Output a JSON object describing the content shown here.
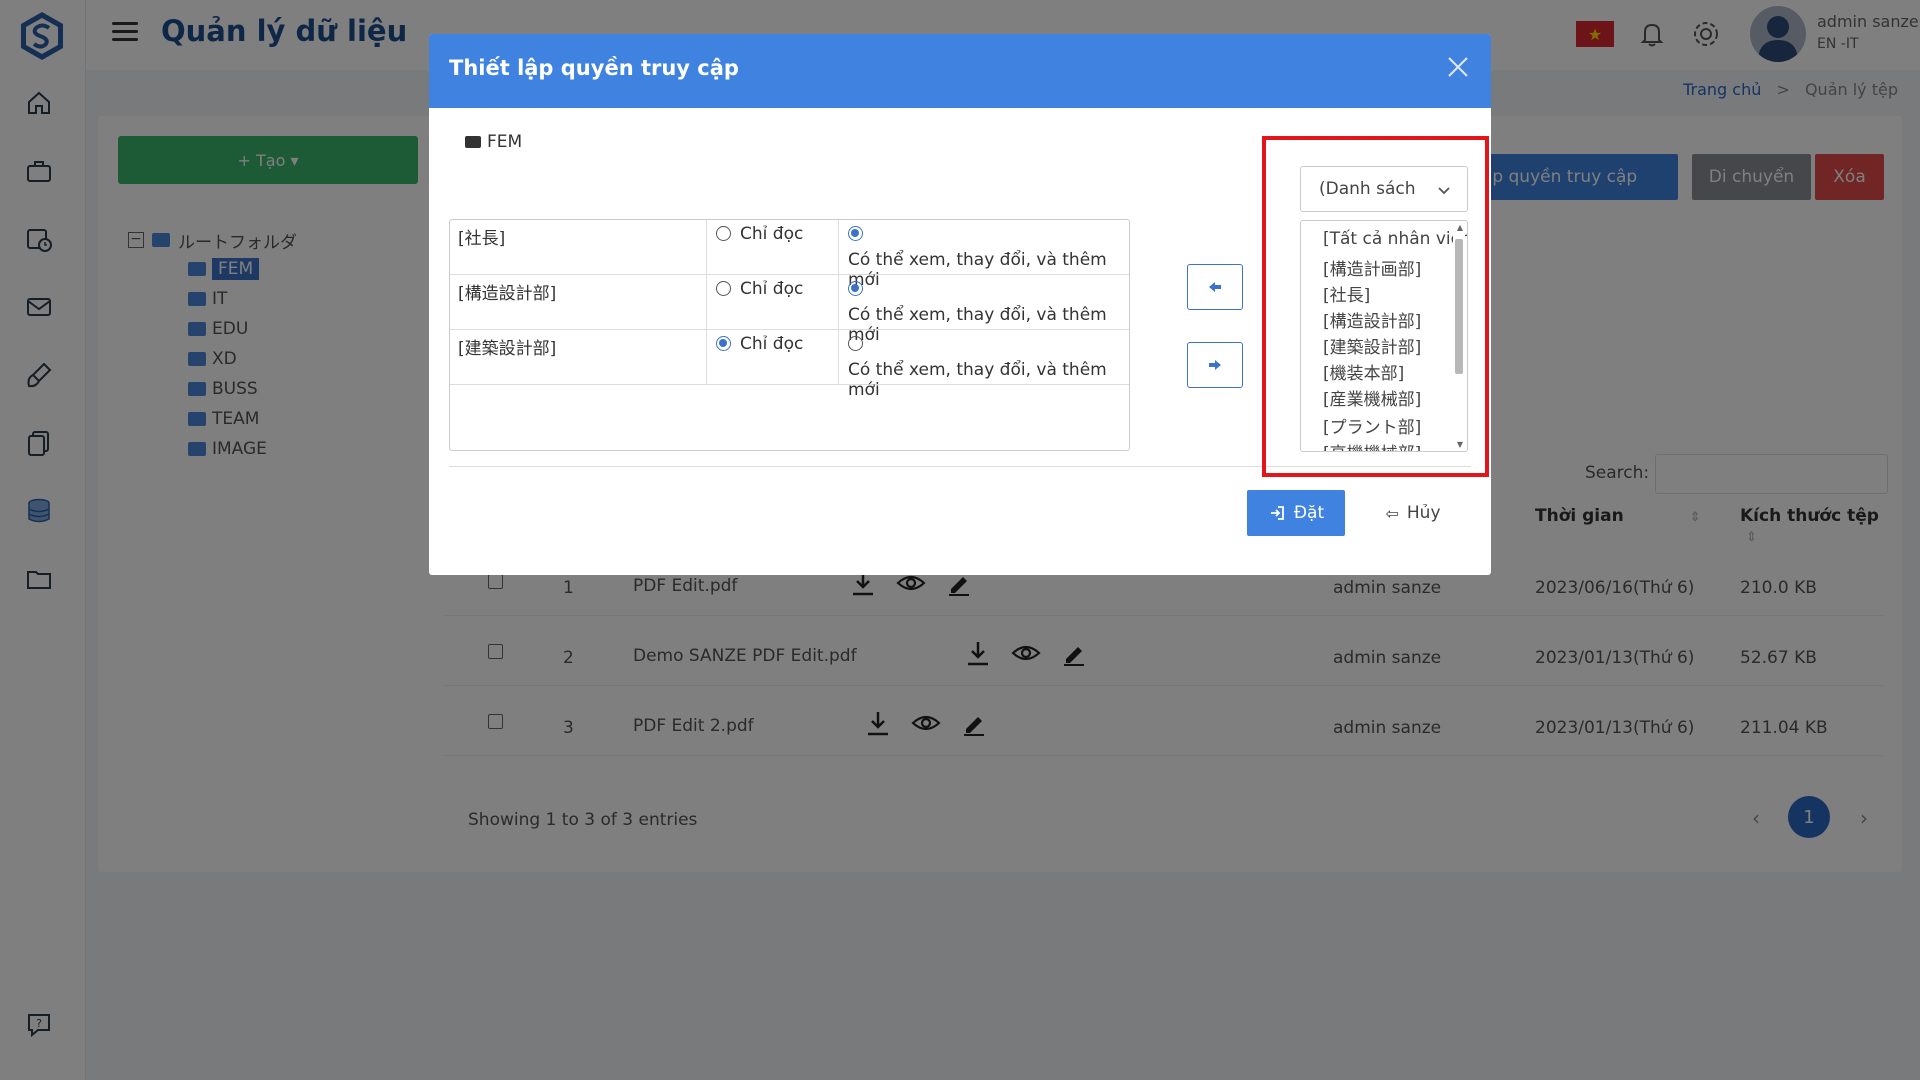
{
  "header": {
    "title": "Quản lý dữ liệu",
    "user_name": "admin sanze",
    "user_sub": "EN -IT",
    "flag_icon": "vietnam-flag-icon"
  },
  "breadcrumb": {
    "home": "Trang chủ",
    "sep": ">",
    "current": "Quản lý tệp"
  },
  "sidebar": {
    "icons": [
      "home-icon",
      "briefcase-icon",
      "calendar-clock-icon",
      "mail-icon",
      "brush-icon",
      "documents-icon",
      "database-icon",
      "folder-icon",
      "help-chat-icon"
    ]
  },
  "content": {
    "create_label": "+ Tạo ▾",
    "tree": {
      "root": "ルートフォルダ",
      "items": [
        "FEM",
        "IT",
        "EDU",
        "XD",
        "BUSS",
        "TEAM",
        "IMAGE"
      ],
      "selected": "FEM"
    },
    "actions": {
      "access": "Thiết lập quyền truy cập",
      "move": "Di chuyển",
      "delete": "Xóa"
    },
    "search_label": "Search:",
    "columns": {
      "time": "Thời gian",
      "size": "Kích thước tệp"
    },
    "rows": [
      {
        "num": "1",
        "name": "PDF Edit.pdf",
        "by": "admin sanze",
        "time": "2023/06/16(Thứ 6)",
        "size": "210.0 KB"
      },
      {
        "num": "2",
        "name": "Demo SANZE PDF Edit.pdf",
        "by": "admin sanze",
        "time": "2023/01/13(Thứ 6)",
        "size": "52.67 KB"
      },
      {
        "num": "3",
        "name": "PDF Edit 2.pdf",
        "by": "admin sanze",
        "time": "2023/01/13(Thứ 6)",
        "size": "211.04 KB"
      }
    ],
    "showing": "Showing 1 to 3 of 3 entries",
    "pager": {
      "prev": "‹",
      "current": "1",
      "next": "›"
    }
  },
  "modal": {
    "title": "Thiết lập quyền truy cập",
    "folder": "FEM",
    "permissions": [
      {
        "name": "[社長]",
        "read_label": "Chỉ đọc",
        "full_label": "Có thể xem, thay đổi, và thêm mới",
        "selected": "full"
      },
      {
        "name": "[構造設計部]",
        "read_label": "Chỉ đọc",
        "full_label": "Có thể xem, thay đổi, và thêm mới",
        "selected": "full"
      },
      {
        "name": "[建築設計部]",
        "read_label": "Chỉ đọc",
        "full_label": "Có thể xem, thay đổi, và thêm mới",
        "selected": "read"
      }
    ],
    "dropdown_value": "(Danh sách",
    "list_options": [
      "[Tất cả nhân viên",
      "[構造計画部]",
      "[社長]",
      "[構造設計部]",
      "[建築設計部]",
      "[機装本部]",
      "[産業機械部]",
      "[プラント部]",
      "[高機機械部]"
    ],
    "set_label": "Đặt",
    "cancel_label": "Hủy"
  },
  "colors": {
    "primary": "#3f82e0",
    "green": "#3bb56c",
    "danger": "#e2151b"
  }
}
